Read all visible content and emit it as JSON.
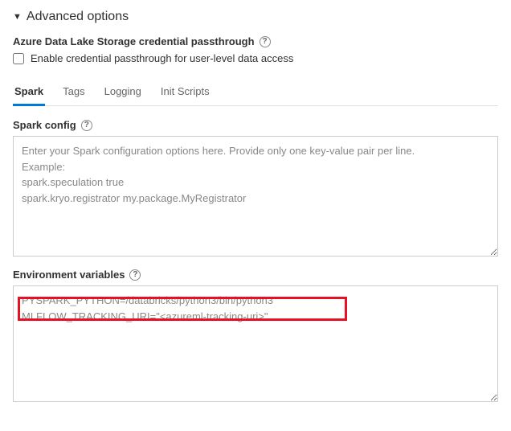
{
  "section": {
    "title": "Advanced options"
  },
  "passthrough": {
    "heading": "Azure Data Lake Storage credential passthrough",
    "checkbox_label": "Enable credential passthrough for user-level data access"
  },
  "tabs": {
    "spark": "Spark",
    "tags": "Tags",
    "logging": "Logging",
    "init_scripts": "Init Scripts"
  },
  "spark_config": {
    "label": "Spark config",
    "placeholder": "Enter your Spark configuration options here. Provide only one key-value pair per line.\nExample:\nspark.speculation true\nspark.kryo.registrator my.package.MyRegistrator"
  },
  "env_vars": {
    "label": "Environment variables",
    "value": "PYSPARK_PYTHON=/databricks/python3/bin/python3\nMLFLOW_TRACKING_URI=\"<azureml-tracking-uri>\""
  }
}
